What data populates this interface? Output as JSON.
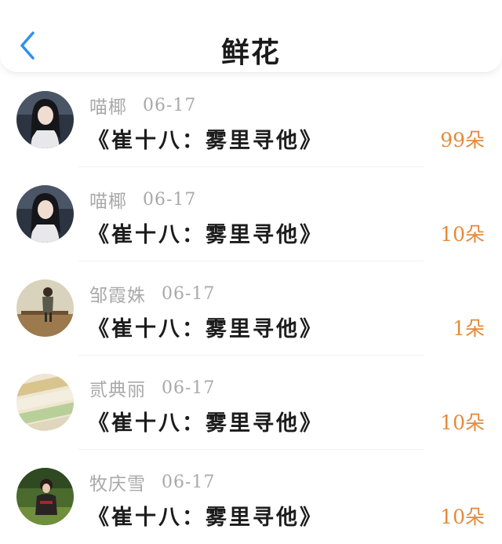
{
  "header": {
    "title": "鲜花",
    "back_icon": "chevron-left-icon",
    "accent_color": "#2f8ff0"
  },
  "items": [
    {
      "name": "喵椰",
      "date": "06-17",
      "book": "《崔十八：雾里寻他》",
      "count": "99朵",
      "avatar": "portrait-dark-hair"
    },
    {
      "name": "喵椰",
      "date": "06-17",
      "book": "《崔十八：雾里寻他》",
      "count": "10朵",
      "avatar": "portrait-dark-hair"
    },
    {
      "name": "邹霞姝",
      "date": "06-17",
      "book": "《崔十八：雾里寻他》",
      "count": "1朵",
      "avatar": "person-on-bench"
    },
    {
      "name": "贰典丽",
      "date": "06-17",
      "book": "《崔十八：雾里寻他》",
      "count": "10朵",
      "avatar": "fabric-rolls"
    },
    {
      "name": "牧庆雪",
      "date": "06-17",
      "book": "《崔十八：雾里寻他》",
      "count": "10朵",
      "avatar": "person-outdoors"
    }
  ],
  "colors": {
    "count_orange": "#e48a3a",
    "meta_gray": "#a9a9a9"
  }
}
